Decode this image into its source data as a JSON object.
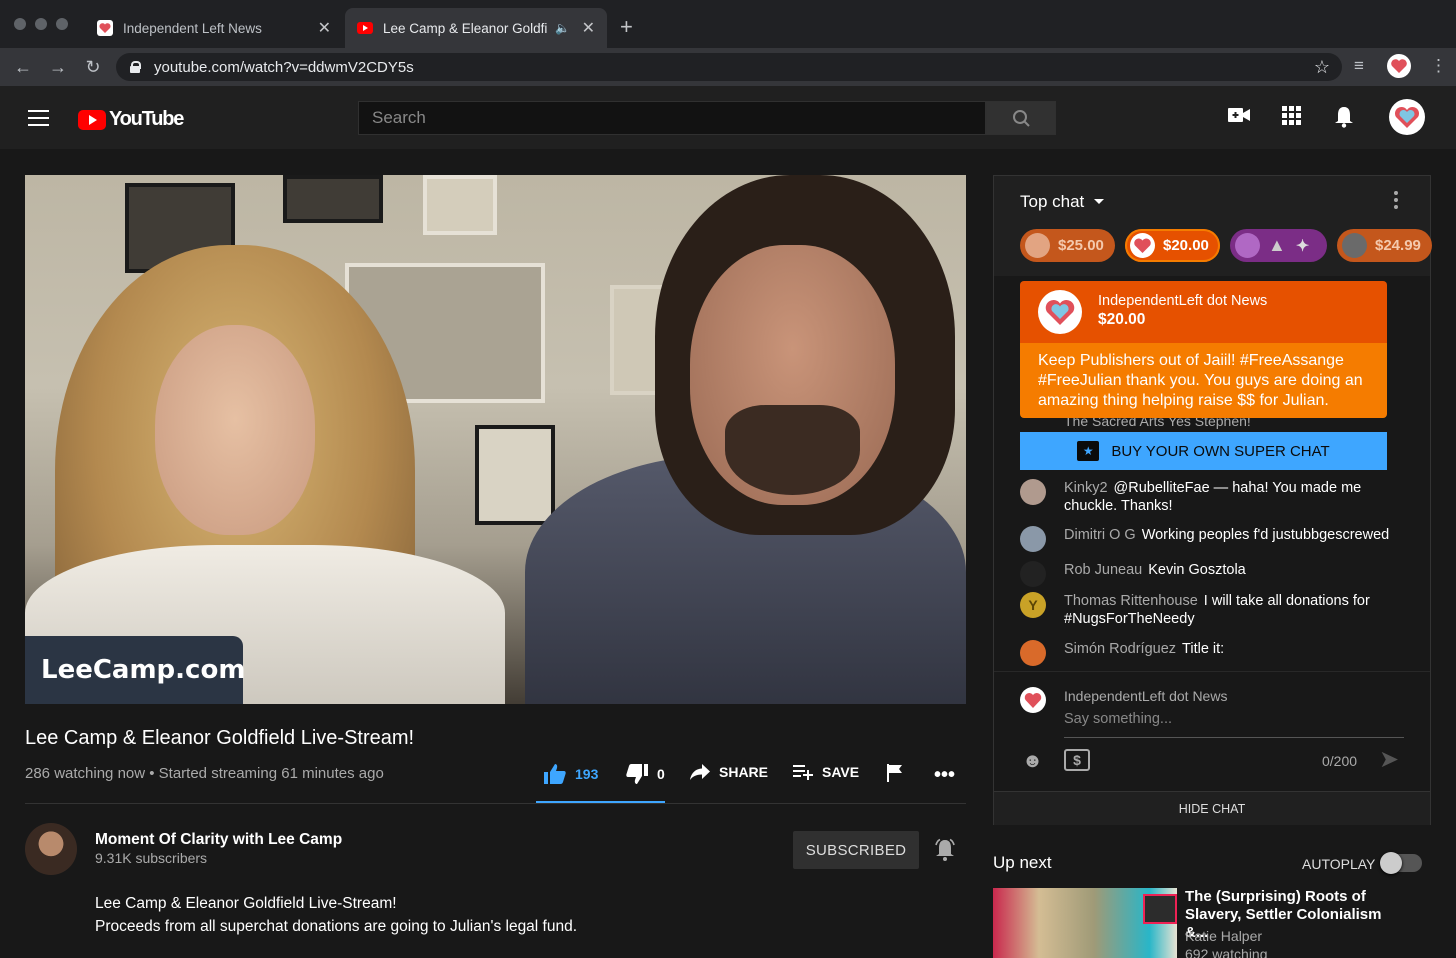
{
  "browser": {
    "tabs": [
      {
        "title": "Independent Left News",
        "favicon": "heart-favicon",
        "active": false
      },
      {
        "title": "Lee Camp & Eleanor Goldfi",
        "favicon": "youtube-favicon",
        "active": true,
        "audio": "speaker-icon"
      }
    ],
    "new_tab_glyph": "+",
    "url": "youtube.com/watch?v=ddwmV2CDY5s"
  },
  "youtube": {
    "logo_text": "YouTube",
    "search_placeholder": "Search"
  },
  "video": {
    "overlay_text": "LeeCamp.com",
    "title": "Lee Camp & Eleanor Goldfield Live-Stream!",
    "stats": "286 watching now • Started streaming 61 minutes ago",
    "likes": "193",
    "dislikes": "0",
    "share_label": "SHARE",
    "save_label": "SAVE"
  },
  "channel": {
    "name": "Moment Of Clarity with Lee Camp",
    "subscribers": "9.31K subscribers",
    "subscribe_label": "SUBSCRIBED"
  },
  "description": {
    "line1": "Lee Camp & Eleanor Goldfield Live-Stream!",
    "line2": "Proceeds from all superchat donations are going to Julian's legal fund."
  },
  "chat": {
    "mode_label": "Top chat",
    "tickers": [
      {
        "amount": "$25.00",
        "color": "#c4571c"
      },
      {
        "amount": "$20.00",
        "color": "#e65100"
      },
      {
        "amount": "",
        "color": "#7b2d86"
      },
      {
        "amount": "$24.99",
        "color": "#c4571c"
      }
    ],
    "superchat": {
      "author": "IndependentLeft dot News",
      "amount": "$20.00",
      "message": "Keep Publishers out of Jaiil! #FreeAssange #FreeJulian thank you. You guys are doing an amazing thing helping raise $$ for Julian."
    },
    "partial_message": "The Sacred Arts   Yes Stephen!",
    "buy_label": "BUY YOUR OWN SUPER CHAT",
    "messages": [
      {
        "author": "Kinky2",
        "text": "@RubelliteFae — haha! You made me chuckle. Thanks!"
      },
      {
        "author": "Dimitri O G",
        "text": "Working peoples f'd justubbgescrewed"
      },
      {
        "author": "Rob Juneau",
        "text": "Kevin Gosztola"
      },
      {
        "author": "Thomas Rittenhouse",
        "text": "I will take all donations for #NugsForTheNeedy"
      },
      {
        "author": "Simón Rodríguez",
        "text": "Title it:"
      }
    ],
    "composer": {
      "name": "IndependentLeft dot News",
      "placeholder": "Say something...",
      "counter": "0/200"
    },
    "hide_label": "HIDE CHAT"
  },
  "upnext": {
    "heading": "Up next",
    "autoplay_label": "AUTOPLAY",
    "autoplay_on": false,
    "item": {
      "title": "The (Surprising) Roots of Slavery, Settler Colonialism &...",
      "channel": "Katie Halper",
      "views": "692 watching"
    }
  },
  "colors": {
    "accent": "#3ea6ff",
    "superchat_header": "#e65100",
    "superchat_body": "#f57c00",
    "yt_red": "#ff0000"
  }
}
